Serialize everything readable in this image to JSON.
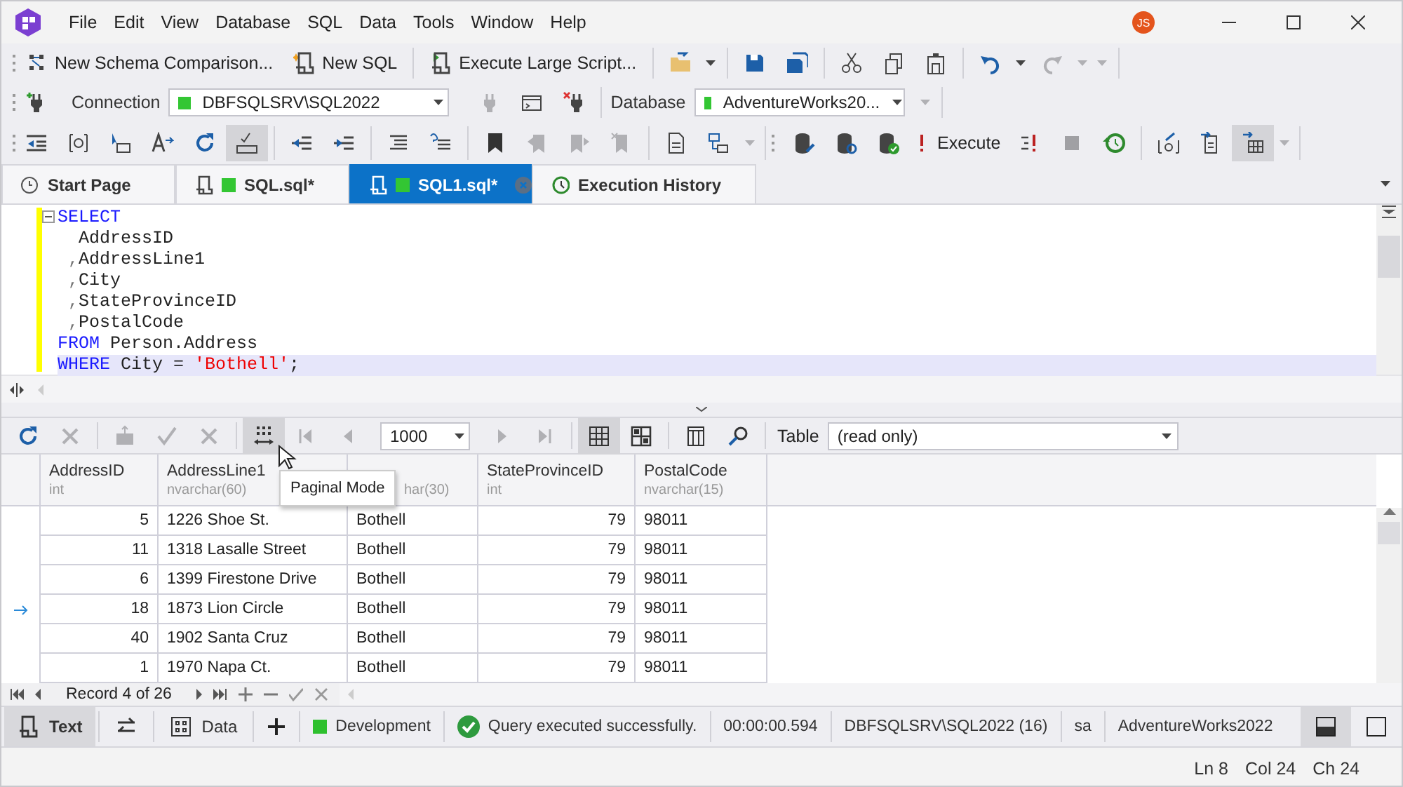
{
  "menu": [
    "File",
    "Edit",
    "View",
    "Database",
    "SQL",
    "Data",
    "Tools",
    "Window",
    "Help"
  ],
  "user_avatar": "JS",
  "toolbar_1": [
    {
      "label": "New Schema Comparison..."
    },
    {
      "label": "New SQL"
    },
    {
      "label": "Execute Large Script..."
    }
  ],
  "connection": {
    "label": "Connection",
    "value": "DBFSQLSRV\\SQL2022",
    "color": "#33c633"
  },
  "database": {
    "label": "Database",
    "value": "AdventureWorks20...",
    "color": "#33c633"
  },
  "toolbar_3": {
    "sql_format_pressed": true,
    "execute_label": "Execute",
    "grid_output_pressed": true
  },
  "tabs": [
    {
      "kind": "page",
      "label": "Start Page",
      "selected": false
    },
    {
      "kind": "sql",
      "label": "SQL.sql*",
      "color": "#33c633",
      "selected": false
    },
    {
      "kind": "sql",
      "label": "SQL1.sql*",
      "color": "#33c633",
      "selected": true
    },
    {
      "kind": "history",
      "label": "Execution History",
      "selected": false
    }
  ],
  "editor": {
    "lines": [
      {
        "current": false,
        "tokens": [
          {
            "kind": "keyword",
            "text": "SELECT"
          }
        ]
      },
      {
        "current": false,
        "tokens": [
          {
            "kind": "plain",
            "text": "  AddressID"
          }
        ]
      },
      {
        "current": false,
        "tokens": [
          {
            "kind": "punct",
            "text": " ,"
          },
          {
            "kind": "plain",
            "text": "AddressLine1"
          }
        ]
      },
      {
        "current": false,
        "tokens": [
          {
            "kind": "punct",
            "text": " ,"
          },
          {
            "kind": "plain",
            "text": "City"
          }
        ]
      },
      {
        "current": false,
        "tokens": [
          {
            "kind": "punct",
            "text": " ,"
          },
          {
            "kind": "plain",
            "text": "StateProvinceID"
          }
        ]
      },
      {
        "current": false,
        "tokens": [
          {
            "kind": "punct",
            "text": " ,"
          },
          {
            "kind": "plain",
            "text": "PostalCode"
          }
        ]
      },
      {
        "current": false,
        "tokens": [
          {
            "kind": "keyword",
            "text": "FROM"
          },
          {
            "kind": "plain",
            "text": " Person.Address"
          }
        ]
      },
      {
        "current": true,
        "tokens": [
          {
            "kind": "keyword",
            "text": "WHERE"
          },
          {
            "kind": "plain",
            "text": " City = "
          },
          {
            "kind": "string",
            "text": "'Bothell'"
          },
          {
            "kind": "plain",
            "text": ";"
          }
        ]
      }
    ]
  },
  "grid_toolbar": {
    "paginal_mode_pressed": true,
    "grid_view_pressed": true,
    "page_size": "1000",
    "table_label": "Table",
    "table_value": "(read only)"
  },
  "tooltip": "Paginal Mode",
  "grid": {
    "columns": [
      {
        "name": "AddressID",
        "type": "int",
        "kind": "number"
      },
      {
        "name": "AddressLine1",
        "type": "nvarchar(60)",
        "kind": "text"
      },
      {
        "type": "har(30)",
        "kind": "text"
      },
      {
        "name": "StateProvinceID",
        "type": "int",
        "kind": "number"
      },
      {
        "name": "PostalCode",
        "type": "nvarchar(15)",
        "kind": "text"
      }
    ],
    "rows": [
      {
        "selected": false,
        "cells": [
          "5",
          "1226 Shoe St.",
          "Bothell",
          "79",
          "98011"
        ]
      },
      {
        "selected": false,
        "cells": [
          "11",
          "1318 Lasalle Street",
          "Bothell",
          "79",
          "98011"
        ]
      },
      {
        "selected": false,
        "cells": [
          "6",
          "1399 Firestone Drive",
          "Bothell",
          "79",
          "98011"
        ]
      },
      {
        "selected": true,
        "cells": [
          "18",
          "1873 Lion Circle",
          "Bothell",
          "79",
          "98011"
        ]
      },
      {
        "selected": false,
        "cells": [
          "40",
          "1902 Santa Cruz",
          "Bothell",
          "79",
          "98011"
        ]
      },
      {
        "selected": false,
        "cells": [
          "1",
          "1970 Napa Ct.",
          "Bothell",
          "79",
          "98011"
        ]
      }
    ]
  },
  "navigator": "Record 4 of 26",
  "result_tabs": [
    {
      "kind": "text",
      "label": "Text",
      "selected": true
    },
    {
      "kind": "swap",
      "selected": false
    },
    {
      "kind": "data",
      "label": "Data",
      "selected": false
    }
  ],
  "status": {
    "environment": {
      "label": "Development",
      "color": "#2ec02e"
    },
    "message": "Query executed successfully.",
    "duration": "00:00:00.594",
    "server": "DBFSQLSRV\\SQL2022 (16)",
    "user": "sa",
    "database": "AdventureWorks2022",
    "layout_split_pressed": true
  },
  "caret": {
    "ln": "Ln 8",
    "col": "Col 24",
    "ch": "Ch 24"
  }
}
